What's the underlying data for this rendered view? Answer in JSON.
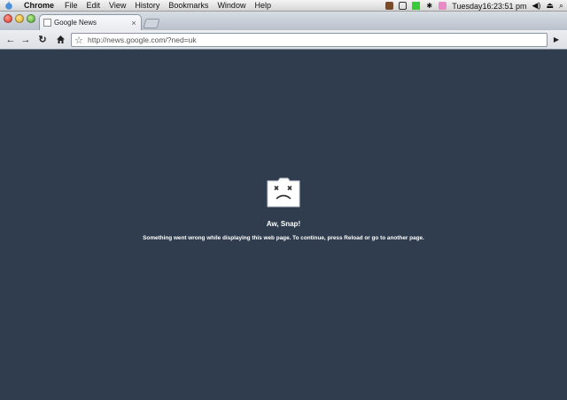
{
  "menubar": {
    "app_name": "Chrome",
    "items": [
      "File",
      "Edit",
      "View",
      "History",
      "Bookmarks",
      "Window",
      "Help"
    ],
    "clock": "Tuesday16:23:51 pm"
  },
  "tab": {
    "title": "Google News"
  },
  "omnibox": {
    "url": "http://news.google.com/?ned=uk"
  },
  "error": {
    "title": "Aw, Snap!",
    "message": "Something went wrong while displaying this web page. To continue, press Reload or go to another page."
  }
}
